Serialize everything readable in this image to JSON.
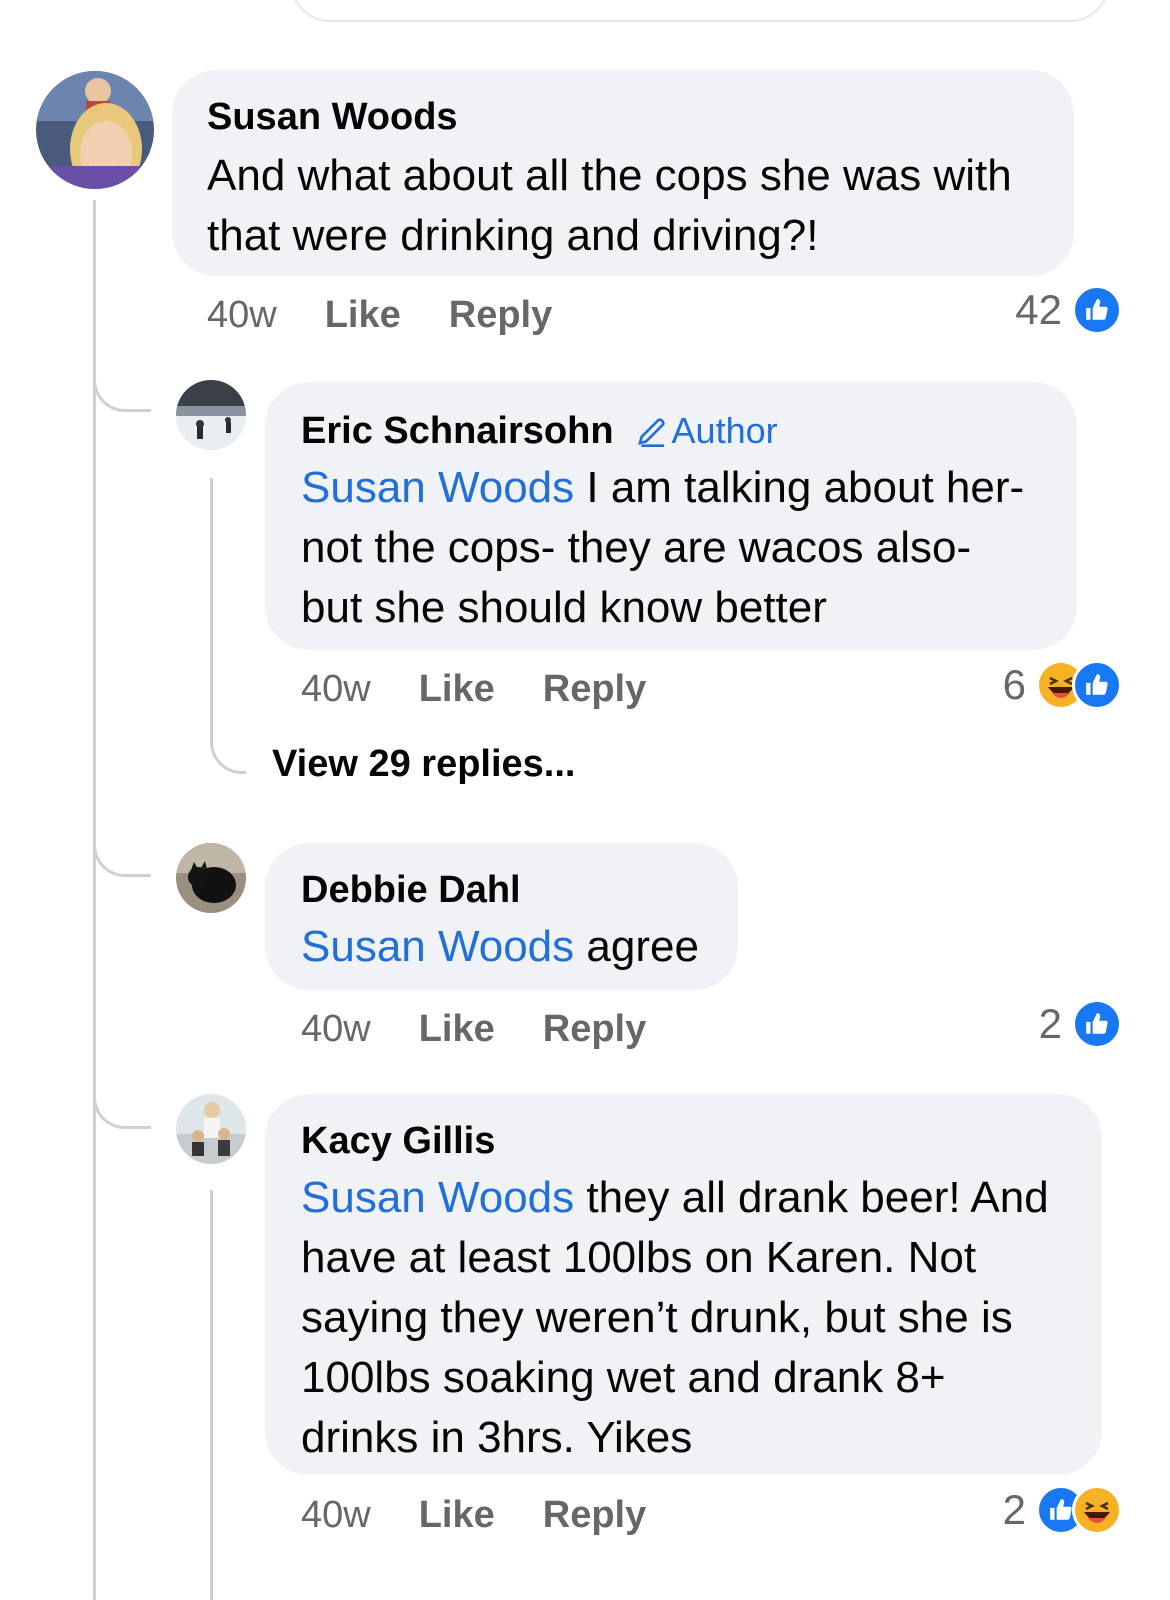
{
  "comments": [
    {
      "author": "Susan Woods",
      "text": "And what about all the cops she was with that were drinking and driving?!",
      "time": "40w",
      "like_label": "Like",
      "reply_label": "Reply",
      "reaction_count": "42",
      "reactions": [
        "like-icon"
      ]
    },
    {
      "author": "Eric Schnairsohn",
      "badge": "Author",
      "mention": "Susan Woods",
      "text": "I am talking about her- not the cops- they are wacos also- but she should know better",
      "time": "40w",
      "like_label": "Like",
      "reply_label": "Reply",
      "reaction_count": "6",
      "reactions": [
        "haha-icon",
        "like-icon"
      ]
    },
    {
      "author": "Debbie Dahl",
      "mention": "Susan Woods",
      "text": "agree",
      "time": "40w",
      "like_label": "Like",
      "reply_label": "Reply",
      "reaction_count": "2",
      "reactions": [
        "like-icon"
      ]
    },
    {
      "author": "Kacy Gillis",
      "mention": "Susan Woods",
      "text": "they all drank beer! And have at least 100lbs on Karen. Not saying they weren’t drunk, but she is 100lbs soaking wet and drank 8+ drinks in 3hrs. Yikes",
      "time": "40w",
      "like_label": "Like",
      "reply_label": "Reply",
      "reaction_count": "2",
      "reactions": [
        "like-icon",
        "haha-icon"
      ]
    }
  ],
  "view_replies": "View 29 replies...",
  "colors": {
    "bubble": "#f0f2f5",
    "mention": "#216fdb",
    "like_blue": "#1877f2",
    "haha_yellow": "#f7b125",
    "meta_gray": "#65676b",
    "thread_line": "#ced0d4"
  }
}
